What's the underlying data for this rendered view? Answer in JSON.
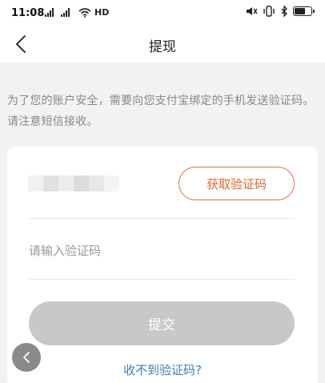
{
  "status_bar": {
    "time": "11:08",
    "network": "HD",
    "battery_level": 0.7
  },
  "nav": {
    "back_icon": "chevron-left-icon",
    "title": "提现"
  },
  "notice": "为了您的账户安全，需要向您支付宝绑定的手机发送验证码。请注意短信接收。",
  "form": {
    "get_code_label": "获取验证码",
    "code_placeholder": "请输入验证码",
    "code_value": "",
    "submit_label": "提交",
    "no_code_link": "收不到验证码?"
  },
  "floating_back_icon": "chevron-left-icon",
  "colors": {
    "accent": "#e4632c",
    "link": "#3d7fb5",
    "disabled_button": "#c8c8c8",
    "background": "#f2f2f2"
  }
}
